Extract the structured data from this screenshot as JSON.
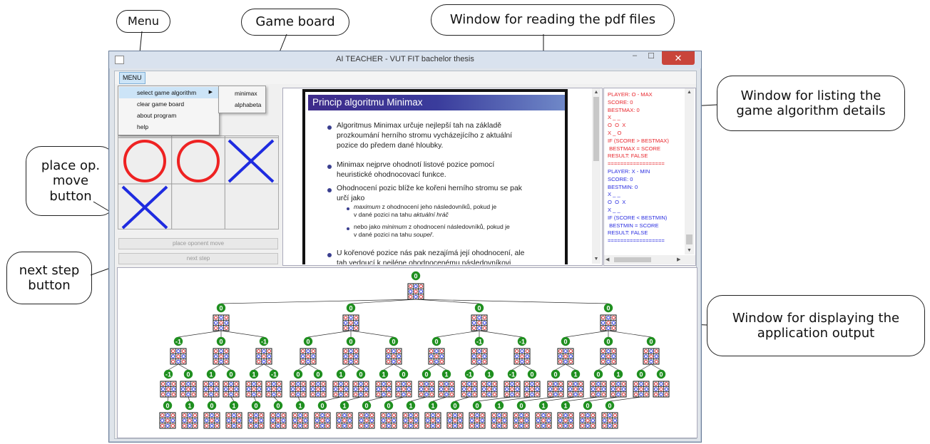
{
  "callouts": {
    "menu": "Menu",
    "game_board": "Game board",
    "pdf_window": "Window for reading the pdf files",
    "details_window": "Window for listing the\ngame algorithm details",
    "place_button": "place op.\nmove\nbutton",
    "next_button": "next step\nbutton",
    "output_window": "Window for displaying the\napplication output"
  },
  "window": {
    "title": "AI TEACHER - VUT FIT bachelor thesis",
    "minimize": "–",
    "maximize": "☐",
    "close": "✕"
  },
  "menu": {
    "label": "MENU",
    "items": [
      "select game algorithm",
      "clear game board",
      "about program",
      "help"
    ],
    "submenu": [
      "minimax",
      "alphabeta"
    ]
  },
  "board": {
    "cells": [
      "",
      "",
      "",
      "O",
      "O",
      "X",
      "X",
      "",
      ""
    ],
    "colors": {
      "O": "#ee2222",
      "X": "#1e2be0"
    }
  },
  "buttons": {
    "place_opponent": "place oponent move",
    "next_step": "next step"
  },
  "pdf": {
    "title": "Princip algoritmu Minimax",
    "b1": [
      "Algoritmus Minimax určuje nejlepší tah na základě",
      "prozkoumání herního stromu vycházejícího z aktuální",
      "pozice do předem dané hloubky."
    ],
    "b2": [
      "Minimax nejprve ohodnotí listové pozice pomocí",
      "heuristické ohodnocovací funkce."
    ],
    "b3": [
      "Ohodnocení pozic blíže ke kořeni herního stromu se pak",
      "určí jako"
    ],
    "s1a_em": "maximum",
    "s1a_rest": " z ohodnocení jeho následovníků, pokud je",
    "s1b": "v dané pozici na tahu ",
    "s1b_em": "aktuální hráč",
    "s2a_pre": "nebo jako ",
    "s2a_em": "minimum",
    "s2a_rest": " z ohodnocení následovníků, pokud je",
    "s2b": "v dané pozici na tahu ",
    "s2b_em": "soupeř",
    "s2b_end": ".",
    "b4": [
      "U kořenové pozice nás pak nezajímá její ohodnocení, ale",
      "tah vedoucí k nejlépe ohodnocenému následovníkovi."
    ]
  },
  "log": [
    {
      "t": "PLAYER: O - MAX",
      "c": "#e8262c"
    },
    {
      "t": "SCORE: 0",
      "c": "#e8262c"
    },
    {
      "t": "BESTMAX: 0",
      "c": "#e8262c"
    },
    {
      "t": "X _ _",
      "c": "#e8262c"
    },
    {
      "t": "O  O  X",
      "c": "#e8262c"
    },
    {
      "t": "X _ O",
      "c": "#e8262c"
    },
    {
      "t": "IF (SCORE > BESTMAX)",
      "c": "#e8262c"
    },
    {
      "t": " BESTMAX = SCORE",
      "c": "#e8262c"
    },
    {
      "t": "RESULT: FALSE",
      "c": "#e8262c"
    },
    {
      "t": "==================",
      "c": "#e8262c"
    },
    {
      "t": "PLAYER: X - MIN",
      "c": "#2a2de0"
    },
    {
      "t": "SCORE: 0",
      "c": "#2a2de0"
    },
    {
      "t": "BESTMIN: 0",
      "c": "#2a2de0"
    },
    {
      "t": "X _ _",
      "c": "#2a2de0"
    },
    {
      "t": "O  O  X",
      "c": "#2a2de0"
    },
    {
      "t": "X _ _",
      "c": "#2a2de0"
    },
    {
      "t": "IF (SCORE < BESTMIN)",
      "c": "#2a2de0"
    },
    {
      "t": " BESTMIN = SCORE",
      "c": "#2a2de0"
    },
    {
      "t": "RESULT: FALSE",
      "c": "#2a2de0"
    },
    {
      "t": "==================",
      "c": "#2a2de0"
    }
  ],
  "tree": {
    "root": "0",
    "l1": [
      "0",
      "0",
      "0",
      "0"
    ],
    "l2": [
      "-1",
      "0",
      "-1",
      "0",
      "0",
      "0",
      "0",
      "-1",
      "-1",
      "0",
      "0",
      "0"
    ],
    "l3": [
      "-1",
      "0",
      "1",
      "0",
      "1",
      "-1",
      "0",
      "0",
      "1",
      "0",
      "1",
      "0",
      "0",
      "1",
      "-1",
      "1",
      "-1",
      "0",
      "0",
      "1",
      "0",
      "1",
      "0",
      "0"
    ],
    "l4": [
      "0",
      "1",
      "0",
      "1",
      "0",
      "0",
      "1",
      "0",
      "1",
      "0",
      "0",
      "1",
      "1",
      "0",
      "0",
      "1",
      "0",
      "1",
      "1",
      "0",
      "0"
    ],
    "colors": {
      "node": "#1f8f1f",
      "cellRed": "#d8252a",
      "cellBlue": "#1f2be0"
    }
  }
}
